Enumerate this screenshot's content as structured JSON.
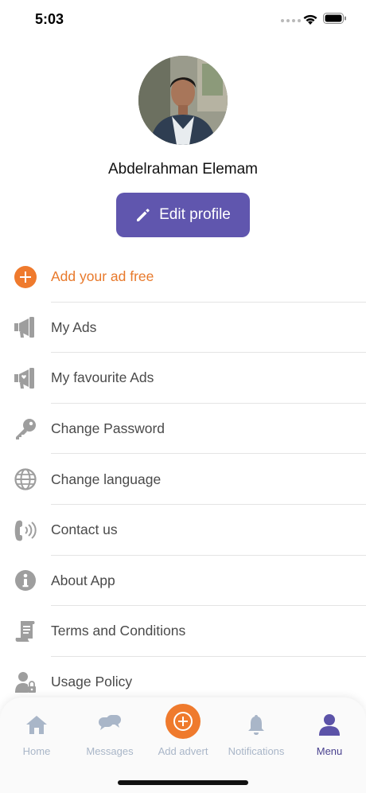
{
  "status": {
    "time": "5:03"
  },
  "profile": {
    "name": "Abdelrahman Elemam",
    "edit_label": "Edit profile"
  },
  "menu": [
    {
      "id": "add-ad",
      "label": "Add your ad free",
      "icon": "plus-circle-icon"
    },
    {
      "id": "my-ads",
      "label": "My Ads",
      "icon": "megaphone-icon"
    },
    {
      "id": "favourite-ads",
      "label": "My favourite Ads",
      "icon": "megaphone-heart-icon"
    },
    {
      "id": "change-password",
      "label": "Change Password",
      "icon": "key-icon"
    },
    {
      "id": "change-language",
      "label": "Change language",
      "icon": "globe-icon"
    },
    {
      "id": "contact-us",
      "label": "Contact us",
      "icon": "phone-icon"
    },
    {
      "id": "about-app",
      "label": "About App",
      "icon": "info-icon"
    },
    {
      "id": "terms",
      "label": "Terms and Conditions",
      "icon": "document-icon"
    },
    {
      "id": "usage-policy",
      "label": "Usage Policy",
      "icon": "user-lock-icon"
    }
  ],
  "tabs": [
    {
      "label": "Home",
      "icon": "home-icon"
    },
    {
      "label": "Messages",
      "icon": "chat-icon"
    },
    {
      "label": "Add advert",
      "icon": "add-circle-icon"
    },
    {
      "label": "Notifications",
      "icon": "bell-icon"
    },
    {
      "label": "Menu",
      "icon": "user-icon"
    }
  ],
  "colors": {
    "accent": "#6056ae",
    "orange": "#ef7a2d",
    "active_tab": "#4a428f",
    "inactive_tab": "#a9b6c8",
    "icon_gray": "#9e9e9e"
  }
}
